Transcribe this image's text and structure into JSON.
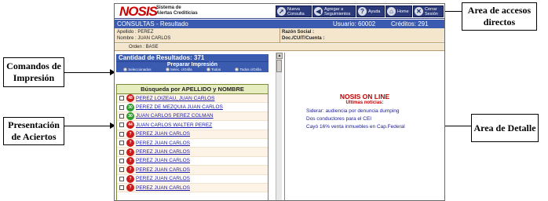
{
  "callouts": {
    "accesos": "Area de accesos directos",
    "impresion": "Comandos de Impresión",
    "aciertos": "Presentación de Aciertos",
    "detalle": "Area de Detalle"
  },
  "app": {
    "logo": "NOSIS",
    "logo_sub_1": "Sistema de",
    "logo_sub_2": "Alertas Crediticias",
    "toolbar": {
      "nueva_consulta": "Nueva Consulta",
      "agregar": "Agregar a Seguimientos",
      "ayuda": "Ayuda",
      "home": "Home",
      "cerrar": "Cerrar Sesión"
    },
    "status": {
      "section": "CONSULTAS - Resultado",
      "usuario": "Usuario: 60002",
      "creditos": "Créditos: 291"
    },
    "info": {
      "apellido": "Apellido : PEREZ",
      "nombre": "Nombre : JUAN CARLOS",
      "razon": "Razón Social :",
      "doc": "Doc./CUIT/Cuenta :",
      "orden": "Orden : BASE"
    }
  },
  "results_header": {
    "cantidad": "Cantidad de Resultados: 371",
    "preparar": "Preparar Impresión",
    "options": [
      "Seleccionados",
      "Selec. c/Grilla",
      "Todos",
      "Todos c/Grilla"
    ]
  },
  "results": {
    "title": "Búsqueda por APELLIDO y NOMBRE",
    "rows": [
      {
        "name": "PEREZ LOIZEAU, JUAN CARLOS",
        "badge": "48",
        "color": "#cc1a1a"
      },
      {
        "name": "PEREZ DE MEZQUIA JUAN CARLOS",
        "badge": "30",
        "color": "#2a9a2a"
      },
      {
        "name": "JUAN CARLOS PEREZ COLMAN",
        "badge": "30",
        "color": "#2a9a2a"
      },
      {
        "name": "JUAN CARLOS WALTER PEREZ",
        "badge": "44",
        "color": "#cc1a1a"
      },
      {
        "name": "PEREZ JUAN CARLOS",
        "badge": "?",
        "color": "#cc1a1a"
      },
      {
        "name": "PEREZ JUAN CARLOS",
        "badge": "?",
        "color": "#cc1a1a"
      },
      {
        "name": "PEREZ JUAN CARLOS",
        "badge": "?",
        "color": "#cc1a1a"
      },
      {
        "name": "PEREZ JUAN CARLOS",
        "badge": "?",
        "color": "#cc1a1a"
      },
      {
        "name": "PEREZ JUAN CARLOS",
        "badge": "?",
        "color": "#cc1a1a"
      },
      {
        "name": "PEREZ JUAN CARLOS",
        "badge": "?",
        "color": "#cc1a1a"
      },
      {
        "name": "PEREZ JUAN CARLOS",
        "badge": "?",
        "color": "#cc1a1a"
      }
    ]
  },
  "detail": {
    "title": "NOSIS ON LINE",
    "subtitle": "Ultimas noticias:",
    "news": [
      "Siderar: audiencia por denuncia dumping",
      "Dos conductores para el CEI",
      "Cayó 16% venta inmuebles en Cap.Federal"
    ]
  }
}
